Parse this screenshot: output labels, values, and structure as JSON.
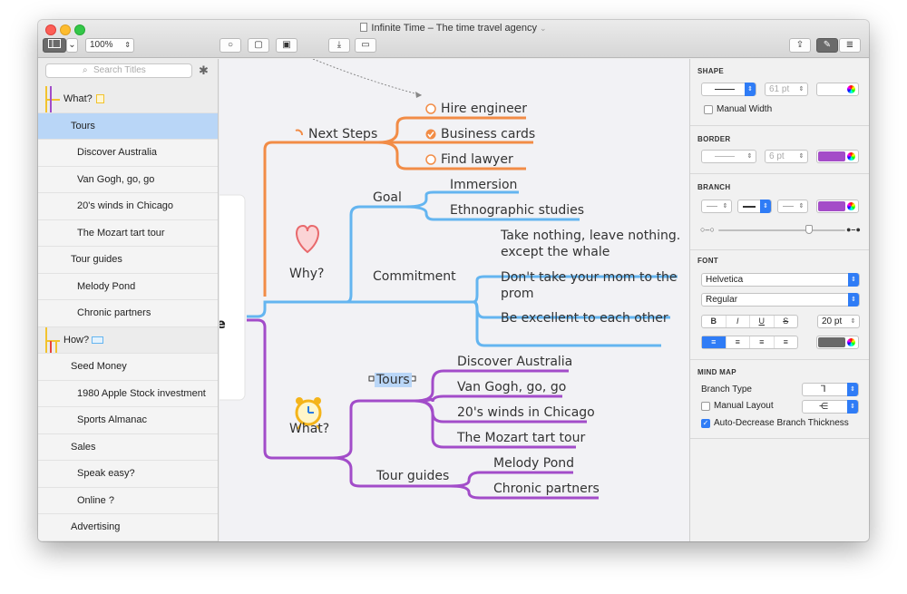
{
  "window": {
    "title": "Infinite Time – The time travel agency"
  },
  "toolbar": {
    "zoom": "100%"
  },
  "sidebar": {
    "search_placeholder": "Search Titles",
    "items": [
      {
        "label": "What?"
      },
      {
        "label": "Tours"
      },
      {
        "label": "Discover Australia"
      },
      {
        "label": "Van Gogh, go, go"
      },
      {
        "label": "20's winds in Chicago"
      },
      {
        "label": "The Mozart tart tour"
      },
      {
        "label": "Tour guides"
      },
      {
        "label": "Melody Pond"
      },
      {
        "label": "Chronic partners"
      },
      {
        "label": "How?"
      },
      {
        "label": "Seed Money"
      },
      {
        "label": "1980 Apple Stock investment"
      },
      {
        "label": "Sports Almanac"
      },
      {
        "label": "Sales"
      },
      {
        "label": "Speak easy?"
      },
      {
        "label": "Online ?"
      },
      {
        "label": "Advertising"
      }
    ]
  },
  "mindmap": {
    "root_partial": "ne",
    "next_steps": "Next Steps",
    "hire": "Hire engineer",
    "cards": "Business cards",
    "lawyer": "Find lawyer",
    "why": "Why?",
    "goal": "Goal",
    "immersion": "Immersion",
    "ethno": "Ethnographic studies",
    "commitment": "Commitment",
    "take1": "Take nothing, leave nothing.",
    "take2": "except the whale",
    "mom1": "Don't take your mom to the",
    "mom2": "prom",
    "excellent": "Be excellent to each other",
    "what": "What?",
    "tours": "Tours",
    "discover": "Discover Australia",
    "vangogh": "Van Gogh, go, go",
    "winds": "20's winds in Chicago",
    "mozart": "The Mozart tart tour",
    "guides": "Tour guides",
    "melody": "Melody Pond",
    "chronic": "Chronic partners"
  },
  "inspector": {
    "shape": {
      "title": "SHAPE",
      "size": "61 pt",
      "manual_width": "Manual Width"
    },
    "border": {
      "title": "BORDER",
      "size": "6 pt"
    },
    "branch": {
      "title": "BRANCH"
    },
    "font": {
      "title": "FONT",
      "family": "Helvetica",
      "style": "Regular",
      "size": "20 pt",
      "bold": "B",
      "italic": "I",
      "underline": "U",
      "strike": "S"
    },
    "mindmap": {
      "title": "MIND MAP",
      "branch_type": "Branch Type",
      "manual_layout": "Manual Layout",
      "auto_decrease": "Auto-Decrease Branch Thickness"
    }
  },
  "colors": {
    "orange": "#f28c46",
    "blue": "#64b5f0",
    "purple": "#a24cc9",
    "swatch_purple": "#a44cc8",
    "swatch_gray": "#6a6a6a",
    "accent": "#2f7cf6"
  }
}
